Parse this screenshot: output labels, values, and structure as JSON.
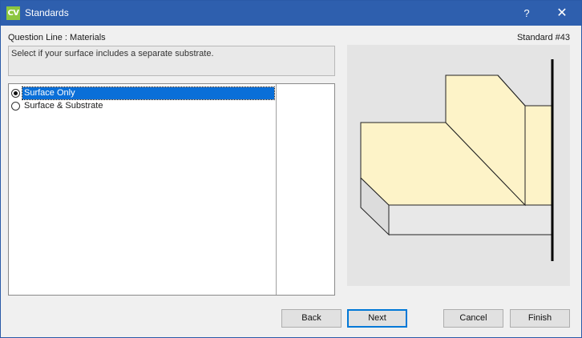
{
  "window": {
    "app_icon_text": "CV",
    "title": "Standards",
    "help_label": "?",
    "close_label": "✕"
  },
  "question": {
    "line_label": "Question Line : Materials",
    "standard_label": "Standard #43",
    "description": "Select if your surface includes a separate substrate."
  },
  "options": [
    {
      "label": "Surface Only",
      "selected": true
    },
    {
      "label": "Surface & Substrate",
      "selected": false
    }
  ],
  "preview": {
    "surface_color": "#fdf3c8",
    "substrate_color": "#e8e8e8",
    "wall_color": "#000000"
  },
  "buttons": {
    "back": "Back",
    "next": "Next",
    "cancel": "Cancel",
    "finish": "Finish"
  }
}
